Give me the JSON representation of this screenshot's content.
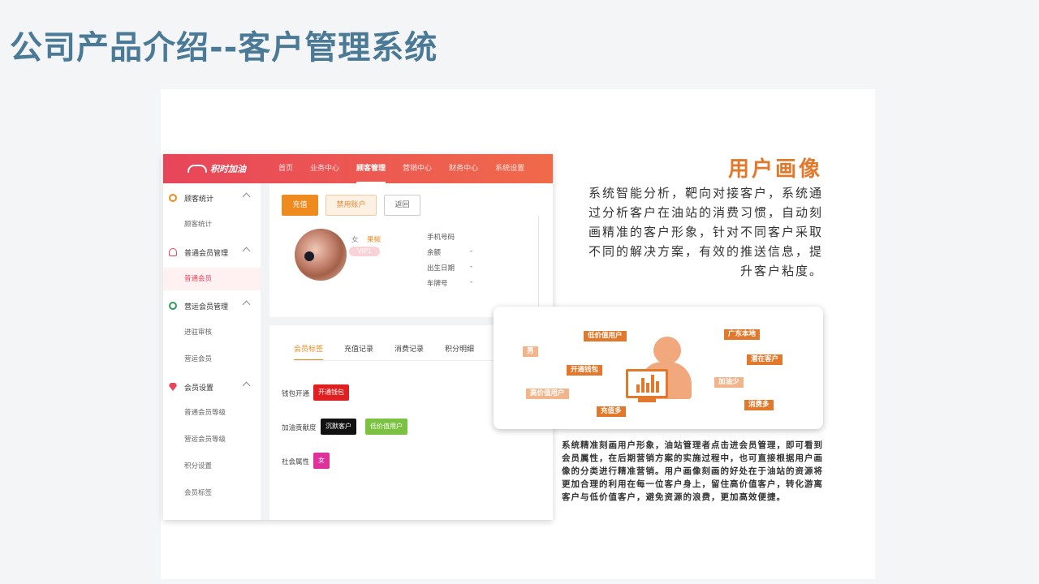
{
  "slide": {
    "title": "公司产品介绍--客户管理系统"
  },
  "app": {
    "logo": "积时加油",
    "nav": [
      {
        "label": "首页",
        "active": false
      },
      {
        "label": "业务中心",
        "active": false
      },
      {
        "label": "顾客管理",
        "active": true
      },
      {
        "label": "营销中心",
        "active": false
      },
      {
        "label": "财务中心",
        "active": false
      },
      {
        "label": "系统设置",
        "active": false
      }
    ],
    "sidebar": {
      "g1": "顾客统计",
      "g1_i1": "顾客统计",
      "g2": "普通会员管理",
      "g2_i1": "普通会员",
      "g3": "营运会员管理",
      "g3_i1": "进驻审核",
      "g3_i2": "营运会员",
      "g4": "会员设置",
      "g4_i1": "普通会员等级",
      "g4_i2": "营运会员等级",
      "g4_i3": "积分设置",
      "g4_i4": "会员标签"
    },
    "buttons": {
      "recharge": "充值",
      "disable": "禁用账户",
      "back": "返回"
    },
    "member": {
      "gender": "女",
      "name": "果椒",
      "level": "VIP1",
      "fields": [
        {
          "label": "手机号码",
          "value": ""
        },
        {
          "label": "余额",
          "value": "-"
        },
        {
          "label": "出生日期",
          "value": "-"
        },
        {
          "label": "车牌号",
          "value": "-"
        }
      ]
    },
    "tabs": [
      "会员标签",
      "充值记录",
      "消费记录",
      "积分明细"
    ],
    "attributes": {
      "wallet_label": "钱包开通",
      "wallet_tag": "开通钱包",
      "contrib_label": "加油贡献度",
      "contrib_tag1": "沉默客户",
      "contrib_tag2": "低价值用户",
      "social_label": "社会属性",
      "social_tag": "女"
    }
  },
  "feature": {
    "title": "用户画像",
    "description": "系统智能分析，靶向对接客户，系统通过分析客户在油站的消费习惯，自动刻画精准的客户形象，针对不同客户采取不同的解决方案，有效的推送信息，提升客户粘度。"
  },
  "portrait": {
    "tags": [
      "男",
      "低价值用户",
      "开通钱包",
      "高价值用户",
      "充值多",
      "广东本地",
      "潜在客户",
      "加油少",
      "消费多"
    ]
  },
  "bottom_text": "系统精准刻画用户形象，油站管理者点击进会员管理，即可看到会员属性，在后期营销方案的实施过程中，也可直接根据用户画像的分类进行精准营销。用户画像刻画的好处在于油站的资源将更加合理的利用在每一位客户身上，留住高价值客户，转化游离客户与低价值客户，避免资源的浪费，更加高效便捷。",
  "colors": {
    "title": "#4a7a96",
    "accent": "#e2782b",
    "topbar_start": "#e8455a",
    "topbar_end": "#f06a4a"
  }
}
